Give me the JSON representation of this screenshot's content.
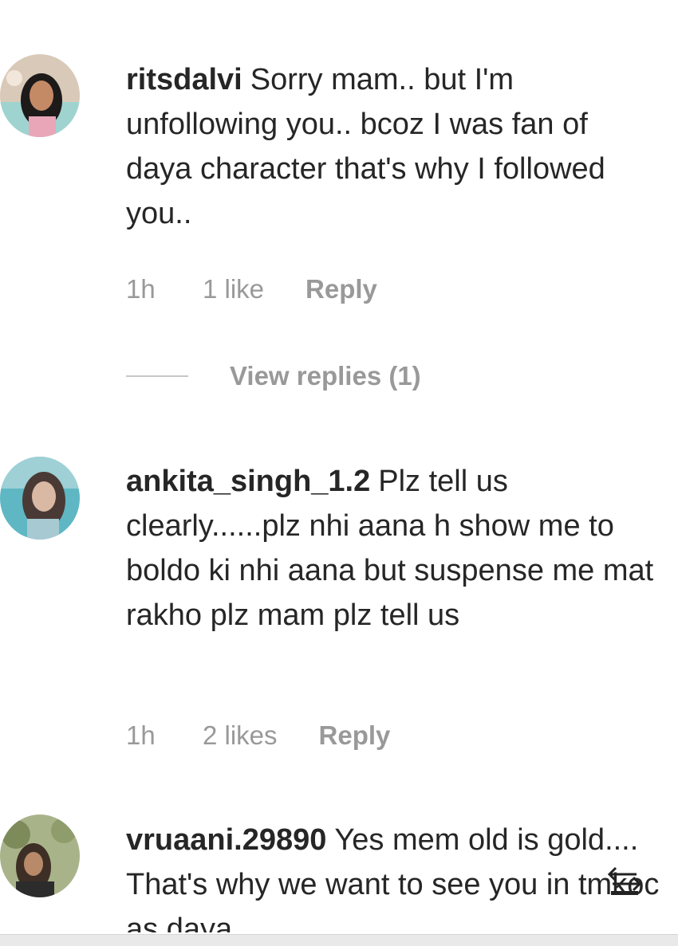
{
  "comments": [
    {
      "username": "ritsdalvi",
      "text": "Sorry mam.. but I'm unfollowing you.. bcoz I was fan of daya character that's why I followed you..",
      "time": "1h",
      "likes": "1 like",
      "reply": "Reply",
      "view_replies": "View replies (1)"
    },
    {
      "username": "ankita_singh_1.2",
      "text": "Plz tell us clearly......plz nhi aana h show me to boldo ki nhi aana but suspense me mat rakho plz mam plz tell us",
      "time": "1h",
      "likes": "2 likes",
      "reply": "Reply"
    },
    {
      "username": "vruaani.29890",
      "text": "Yes mem old is gold.... That's why we want to see you in tmkoc as daya"
    }
  ],
  "icons": {
    "avatar": "avatar",
    "back": "back-arrow-icon"
  },
  "colors": {
    "text": "#262626",
    "meta": "#999999",
    "divider": "#c7c7c7"
  }
}
